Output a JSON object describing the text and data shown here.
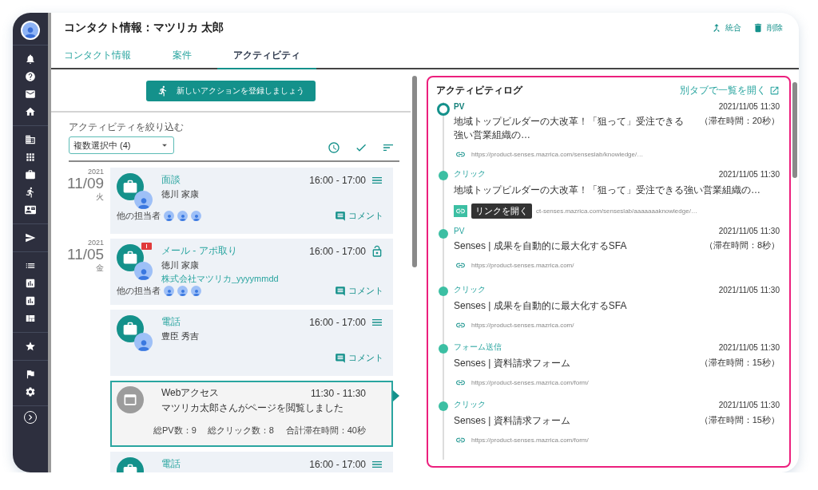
{
  "header": {
    "title": "コンタクト情報：マツリカ 太郎",
    "actions": [
      {
        "kind": "merge",
        "label": "統合"
      },
      {
        "kind": "delete",
        "label": "削除"
      }
    ]
  },
  "tabs": [
    {
      "label": "コンタクト情報",
      "selected": false
    },
    {
      "label": "案件",
      "selected": false
    },
    {
      "label": "アクティビティ",
      "selected": true
    }
  ],
  "new_action_button": {
    "label": "新しいアクションを登録しましょう"
  },
  "filter": {
    "label": "アクティビティを絞り込む",
    "value": "複数選択中 (4)"
  },
  "timeline": [
    {
      "year": "2021",
      "date": "11/09",
      "weekday": "火",
      "items": [
        {
          "kind": "task",
          "title": "面談",
          "time": "16:00 - 17:00",
          "locked": false,
          "alert": false,
          "person": "徳川 家康",
          "co_label": "他の担当者",
          "comment": "コメント"
        }
      ]
    },
    {
      "year": "2021",
      "date": "11/05",
      "weekday": "金",
      "items": [
        {
          "kind": "task",
          "title": "メール - アポ取り",
          "time": "16:00 - 17:00",
          "locked": true,
          "alert": true,
          "person": "徳川 家康",
          "company": "株式会社マツリカ_yyyymmdd",
          "co_label": "他の担当者",
          "comment": "コメント"
        },
        {
          "kind": "task",
          "title": "電話",
          "time": "16:00 - 17:00",
          "locked": false,
          "alert": false,
          "person": "豊臣 秀吉",
          "comment": "コメント"
        },
        {
          "kind": "web",
          "selected": true,
          "title": "Webアクセス",
          "time": "11:30 - 11:30",
          "description": "マツリカ太郎さんがページを閲覧しました",
          "stats": [
            "総PV数：9",
            "総クリック数：8"
          ],
          "total": "合計滞在時間：40秒"
        },
        {
          "kind": "task",
          "title": "電話",
          "time": "16:00 - 17:00",
          "locked": false,
          "alert": false
        }
      ]
    }
  ],
  "log": {
    "title": "アクティビティログ",
    "open_link": "別タブで一覧を開く",
    "entries": [
      {
        "type": "PV",
        "current": true,
        "datetime": "2021/11/05 11:30",
        "title": "地域トップビルダーの大改革！「狙って」受注できる強い営業組織の…",
        "stay": "（滞在時間：20秒）",
        "url": "https://product-senses.mazrica.com/senseslab/knowledge/…"
      },
      {
        "type": "クリック",
        "current": false,
        "datetime": "2021/11/05 11:30",
        "title": "地域トップビルダーの大改革！「狙って」受注できる強い営業組織の…",
        "tooltip": "リンクを開く",
        "url": "ct-senses.mazrica.com/senseslab/aaaaaaaknowledge/…"
      },
      {
        "type": "PV",
        "current": false,
        "datetime": "2021/11/05 11:30",
        "title": "Senses | 成果を自動的に最大化するSFA",
        "stay": "（滞在時間：8秒）",
        "url": "https://product-senses.mazrica.com/"
      },
      {
        "type": "クリック",
        "current": false,
        "datetime": "2021/11/05 11:30",
        "title": "Senses | 成果を自動的に最大化するSFA",
        "url": "https://product-senses.mazrica.com/"
      },
      {
        "type": "フォーム送信",
        "current": false,
        "datetime": "2021/11/05 11:30",
        "title": "Senses | 資料請求フォーム",
        "stay": "（滞在時間：15秒）",
        "url": "https://product-senses.mazrica.com/form/"
      },
      {
        "type": "クリック",
        "current": false,
        "datetime": "2021/11/05 11:30",
        "title": "Senses | 資料請求フォーム",
        "stay": "（滞在時間：15秒）",
        "url": "https://product-senses.mazrica.com/form/"
      }
    ]
  }
}
